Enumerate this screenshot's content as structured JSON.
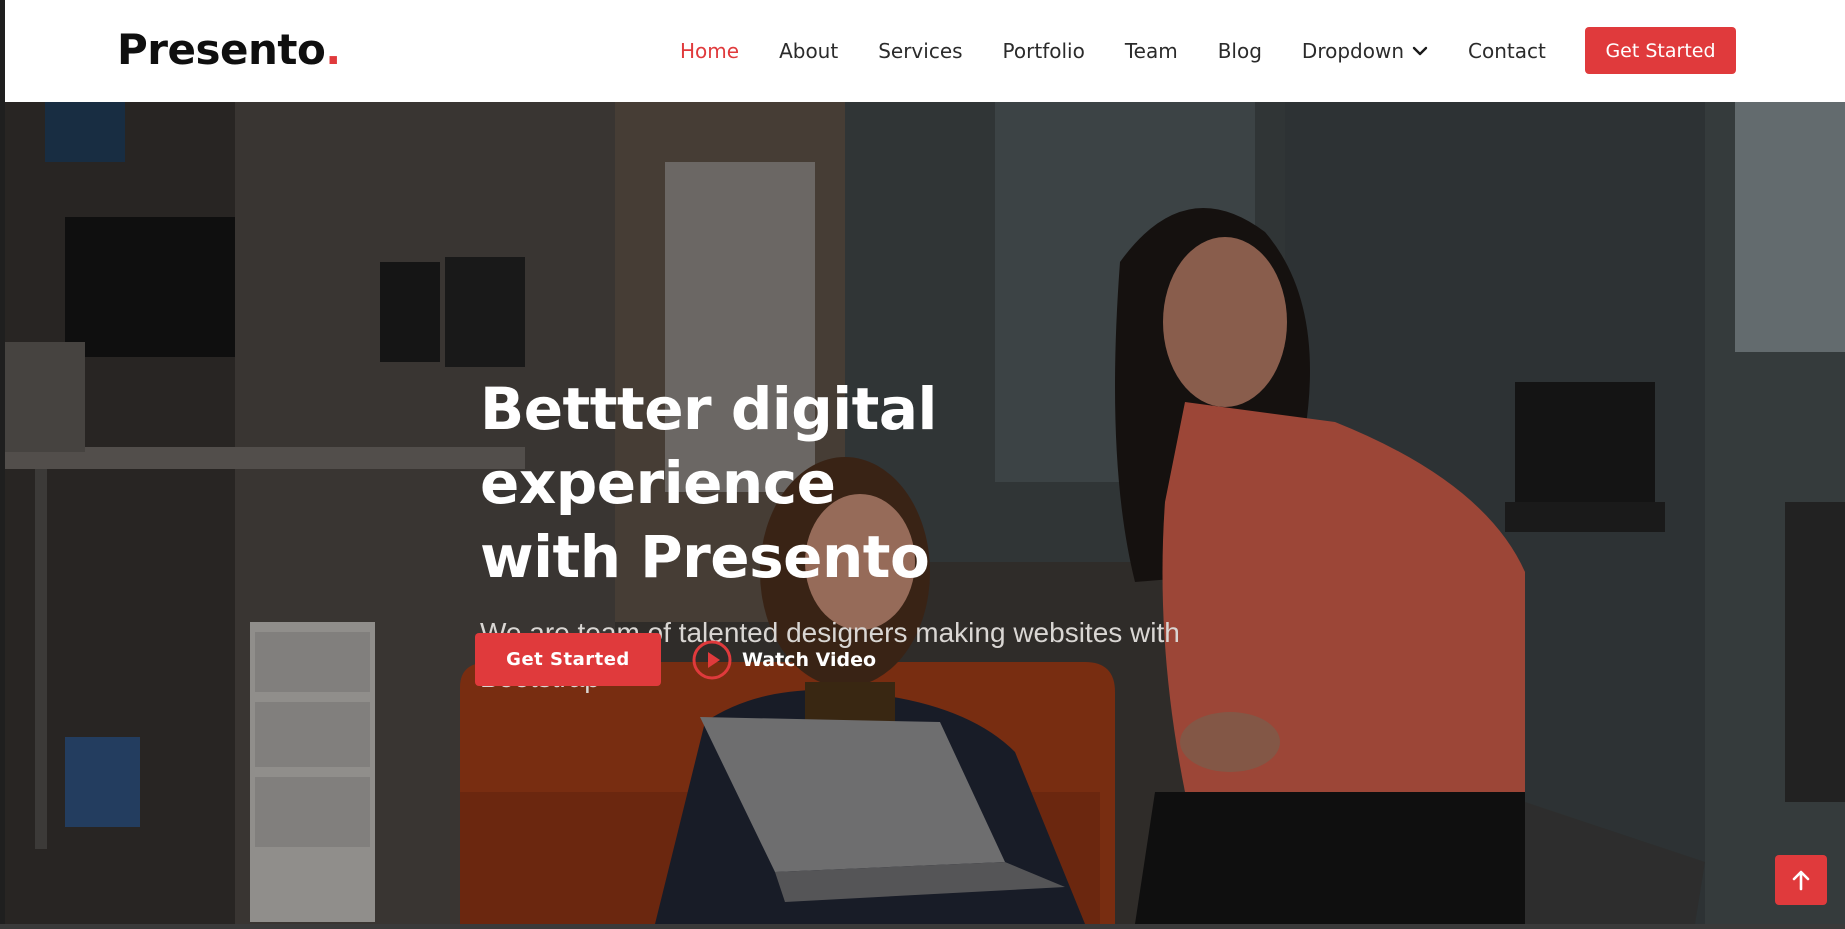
{
  "header": {
    "logo_text": "Presento",
    "logo_dot": ".",
    "nav": [
      {
        "label": "Home",
        "active": true
      },
      {
        "label": "About"
      },
      {
        "label": "Services"
      },
      {
        "label": "Portfolio"
      },
      {
        "label": "Team"
      },
      {
        "label": "Blog"
      },
      {
        "label": "Dropdown",
        "icon": "chevron-down-icon"
      },
      {
        "label": "Contact"
      }
    ],
    "cta_label": "Get Started"
  },
  "hero": {
    "title_line1": "Bettter digital experience",
    "title_line2": "with Presento",
    "subtitle": "We are team of talented designers making websites with Bootstrap",
    "primary_button": "Get Started",
    "video_label": "Watch Video",
    "video_icon": "play-circle-icon"
  },
  "back_to_top": {
    "icon": "arrow-up-icon"
  },
  "colors": {
    "accent": "#e03a3c",
    "nav_text": "#2b2b2b",
    "logo": "#0f0f0f",
    "hero_text": "#ffffff",
    "hero_subtext": "#d9d6d3"
  }
}
